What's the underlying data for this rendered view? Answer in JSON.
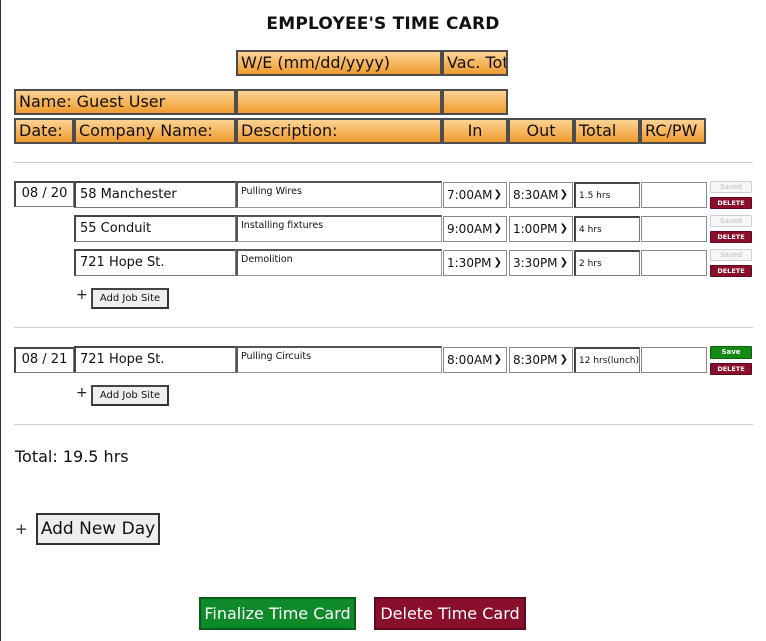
{
  "title": "EMPLOYEE'S TIME CARD",
  "header_top": {
    "we_label": "W/E (mm/dd/yyyy)",
    "vac_label": "Vac. Tot"
  },
  "name_row": {
    "name_label": "Name: Guest User",
    "field2": "",
    "field3": ""
  },
  "columns": {
    "date": "Date:",
    "company": "Company Name:",
    "description": "Description:",
    "in": "In",
    "out": "Out",
    "total": "Total",
    "rcpw": "RC/PW"
  },
  "days": [
    {
      "date": "08 / 20",
      "entries": [
        {
          "company": "58 Manchester",
          "description": "Pulling Wires",
          "in": "7:00AM",
          "out": "8:30AM",
          "total": "1.5 hrs",
          "rcpw": "",
          "save_state": "Saved",
          "delete_label": "DELETE"
        },
        {
          "company": "55 Conduit",
          "description": "Installing fixtures",
          "in": "9:00AM",
          "out": "1:00PM",
          "total": "4 hrs",
          "rcpw": "",
          "save_state": "Saved",
          "delete_label": "DELETE"
        },
        {
          "company": "721 Hope St.",
          "description": "Demolition",
          "in": "1:30PM",
          "out": "3:30PM",
          "total": "2 hrs",
          "rcpw": "",
          "save_state": "Saved",
          "delete_label": "DELETE"
        }
      ],
      "add_plus": "+",
      "add_job_label": "Add Job Site"
    },
    {
      "date": "08 / 21",
      "entries": [
        {
          "company": "721 Hope St.",
          "description": "Pulling Circuits",
          "in": "8:00AM",
          "out": "8:30PM",
          "total": "12 hrs(lunch)",
          "rcpw": "",
          "save_state": "Save",
          "delete_label": "DELETE"
        }
      ],
      "add_plus": "+",
      "add_job_label": "Add Job Site"
    }
  ],
  "total_text": "Total: 19.5 hrs",
  "add_day": {
    "plus": "+",
    "label": "Add New Day"
  },
  "footer": {
    "finalize_label": "Finalize Time Card",
    "delete_label": "Delete Time Card"
  },
  "icons": {
    "dropdown": "chevron-down-icon"
  },
  "colors": {
    "header_orange": "#f6b45a",
    "save_green": "#138a13",
    "delete_red": "#8b0f2c"
  }
}
